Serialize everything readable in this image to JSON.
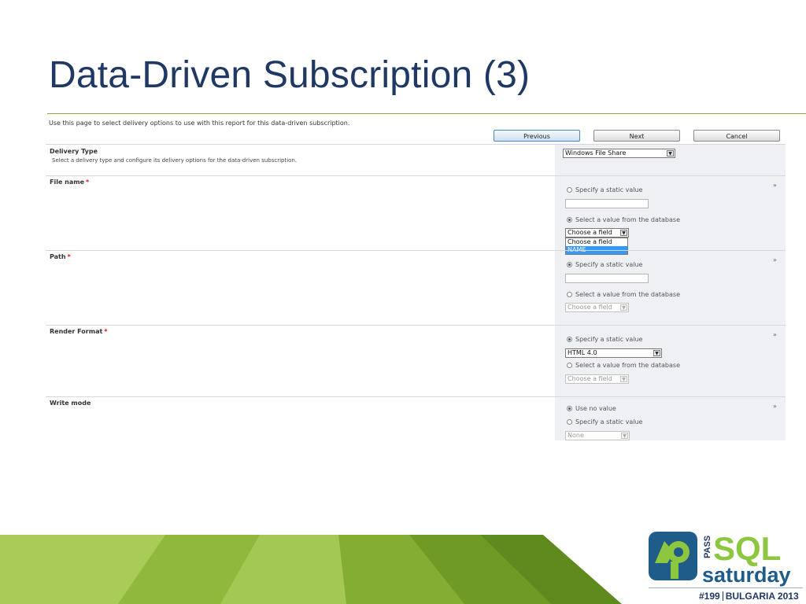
{
  "slide_title": "Data-Driven Subscription (3)",
  "intro_text": "Use this page to select delivery options to use with this report for this data-driven subscription.",
  "buttons": {
    "previous": "Previous",
    "next": "Next",
    "cancel": "Cancel"
  },
  "delivery_type": {
    "label": "Delivery Type",
    "description": "Select a delivery type and configure its delivery options for the data-driven subscription.",
    "selected": "Windows File Share"
  },
  "file_name": {
    "label": "File name",
    "required_mark": "*",
    "option_static": "Specify a static value",
    "option_db": "Select a value from the database",
    "field_select": "Choose a field",
    "dropdown_options": [
      "Choose a field",
      "NAME"
    ]
  },
  "path": {
    "label": "Path",
    "required_mark": "*",
    "option_static": "Specify a static value",
    "option_db": "Select a value from the database",
    "field_select": "Choose a field"
  },
  "render_format": {
    "label": "Render Format",
    "required_mark": "*",
    "option_static": "Specify a static value",
    "format_value": "HTML 4.0",
    "option_db": "Select a value from the database",
    "field_select": "Choose a field"
  },
  "write_mode": {
    "label": "Write mode",
    "option_none": "Use no value",
    "option_static": "Specify a static value",
    "value_select": "None"
  },
  "collapse_glyph": "»",
  "logo": {
    "pass": "PASS",
    "sql": "SQL",
    "saturday": "saturday",
    "event_number": "#199",
    "event_location": "BULGARIA 2013"
  },
  "colors": {
    "title": "#1f3864",
    "accent_green": "#8ab43b",
    "logo_blue": "#1f3864",
    "logo_green": "#8dc63f",
    "selection_blue": "#3399ff"
  }
}
